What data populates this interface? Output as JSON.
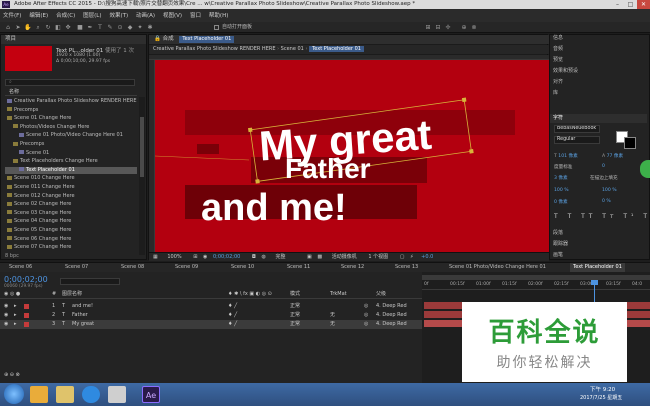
{
  "window": {
    "title": "Adobe After Effects CC 2015 - D:\\搜狗高速下载\\照片交替翻页效果\\Cre ... w\\Creative Parallax Photo Slideshow\\Creative Parallax Photo Slideshow.aep *",
    "app_badge": "Ae",
    "minimize": "–",
    "maximize": "□",
    "close": "✕"
  },
  "menu": [
    "文件(F)",
    "编辑(E)",
    "合成(C)",
    "图层(L)",
    "效果(T)",
    "动画(A)",
    "视图(V)",
    "窗口",
    "帮助(H)"
  ],
  "toolbar": {
    "snap_label": "自动打开面板"
  },
  "project": {
    "panel_title": "项目",
    "preview_name": "Text PL...older 01",
    "preview_used": "使用了 1 次",
    "preview_size": "1920 x 1080 (1.00)",
    "preview_duration": "Δ 0;00;10;00, 29.97 fps",
    "name_header": "名称",
    "items": [
      {
        "label": "Creative Parallax Photo Slideshow RENDER HERE",
        "indent": 0,
        "kind": "comp",
        "selected": false
      },
      {
        "label": "Precomps",
        "indent": 0,
        "kind": "folder",
        "selected": false
      },
      {
        "label": "Scene 01 Change Here",
        "indent": 0,
        "kind": "folder",
        "selected": false
      },
      {
        "label": "Photos/Videos Change Here",
        "indent": 1,
        "kind": "folder",
        "selected": false
      },
      {
        "label": "Scene 01 Photo/Video Change Here 01",
        "indent": 2,
        "kind": "comp",
        "selected": false
      },
      {
        "label": "Precomps",
        "indent": 1,
        "kind": "folder",
        "selected": false
      },
      {
        "label": "Scene 01",
        "indent": 2,
        "kind": "comp",
        "selected": false
      },
      {
        "label": "Text Placeholders Change Here",
        "indent": 1,
        "kind": "folder",
        "selected": false
      },
      {
        "label": "Text Placeholder 01",
        "indent": 2,
        "kind": "comp",
        "selected": true
      },
      {
        "label": "Scene 010 Change Here",
        "indent": 0,
        "kind": "folder",
        "selected": false
      },
      {
        "label": "Scene 011 Change Here",
        "indent": 0,
        "kind": "folder",
        "selected": false
      },
      {
        "label": "Scene 012 Change Here",
        "indent": 0,
        "kind": "folder",
        "selected": false
      },
      {
        "label": "Scene 02 Change Here",
        "indent": 0,
        "kind": "folder",
        "selected": false
      },
      {
        "label": "Scene 03 Change Here",
        "indent": 0,
        "kind": "folder",
        "selected": false
      },
      {
        "label": "Scene 04 Change Here",
        "indent": 0,
        "kind": "folder",
        "selected": false
      },
      {
        "label": "Scene 05 Change Here",
        "indent": 0,
        "kind": "folder",
        "selected": false
      },
      {
        "label": "Scene 06 Change Here",
        "indent": 0,
        "kind": "folder",
        "selected": false
      },
      {
        "label": "Scene 07 Change Here",
        "indent": 0,
        "kind": "folder",
        "selected": false
      }
    ],
    "bpc": "8 bpc"
  },
  "viewer": {
    "tab_label": "合成",
    "breadcrumbs": [
      "Creative Parallax Photo Slideshow RENDER HERE",
      "Scene 01",
      "Text Placeholder 01"
    ],
    "text_line1": "My great",
    "text_line2": "Father",
    "text_line3": "and me!",
    "zoom": "100%",
    "timecode": "0;00;02;00",
    "quality": "完整",
    "camera": "活动摄像机",
    "views": "1 个视图",
    "offset": "+0.0",
    "colors": {
      "bg": "#b3000f",
      "dark_band": "#7a0008",
      "text": "#ffffff"
    }
  },
  "right_panel": {
    "items": [
      "信息",
      "音频",
      "预览",
      "效果和预设",
      "对齐",
      "库",
      "字符",
      "段落",
      "跟踪器",
      "画笔"
    ],
    "font_name": "BebasNeueBook",
    "font_style": "Regular",
    "font_size": "101 像素",
    "leading": "77 像素",
    "tracking_label": "度量标准",
    "tracking_value": "0",
    "stroke": "3 像素",
    "stroke_mode": "在描边上填充",
    "vert_scale": "100 %",
    "horiz_scale": "100 %",
    "baseline": "0 像素",
    "tsume": "0 %"
  },
  "timeline": {
    "tabs": [
      "Scene 06",
      "Scene 07",
      "Scene 08",
      "Scene 09",
      "Scene 10",
      "Scene 11",
      "Scene 12",
      "Scene 13",
      "Scene 01 Photo/Video Change Here 01",
      "Text Placeholder 01"
    ],
    "timecode": "0;00;02;00",
    "fps_line": "00060 (29.97 fps)",
    "columns": {
      "num": "#",
      "name": "图层名称",
      "mode": "模式",
      "trkmat": "TrkMat",
      "parent": "父级"
    },
    "layers": [
      {
        "num": "1",
        "name": "and me!",
        "mode": "正常",
        "trkmat": "",
        "parent": "4. Deep Red"
      },
      {
        "num": "2",
        "name": "Father",
        "mode": "正常",
        "trkmat": "无",
        "parent": "4. Deep Red"
      },
      {
        "num": "3",
        "name": "My great",
        "mode": "正常",
        "trkmat": "无",
        "parent": "4. Deep Red"
      }
    ],
    "ruler": [
      "0f",
      "00:15f",
      "01:00f",
      "01:15f",
      "02:00f",
      "02:15f",
      "03:00f",
      "03:15f",
      "04:0"
    ],
    "footer": "切换开关/模式"
  },
  "watermark": {
    "title": "百科全说",
    "subtitle": "助你轻松解决"
  },
  "taskbar": {
    "time": "下午 9:20",
    "date": "2017/7/25 星期五"
  }
}
